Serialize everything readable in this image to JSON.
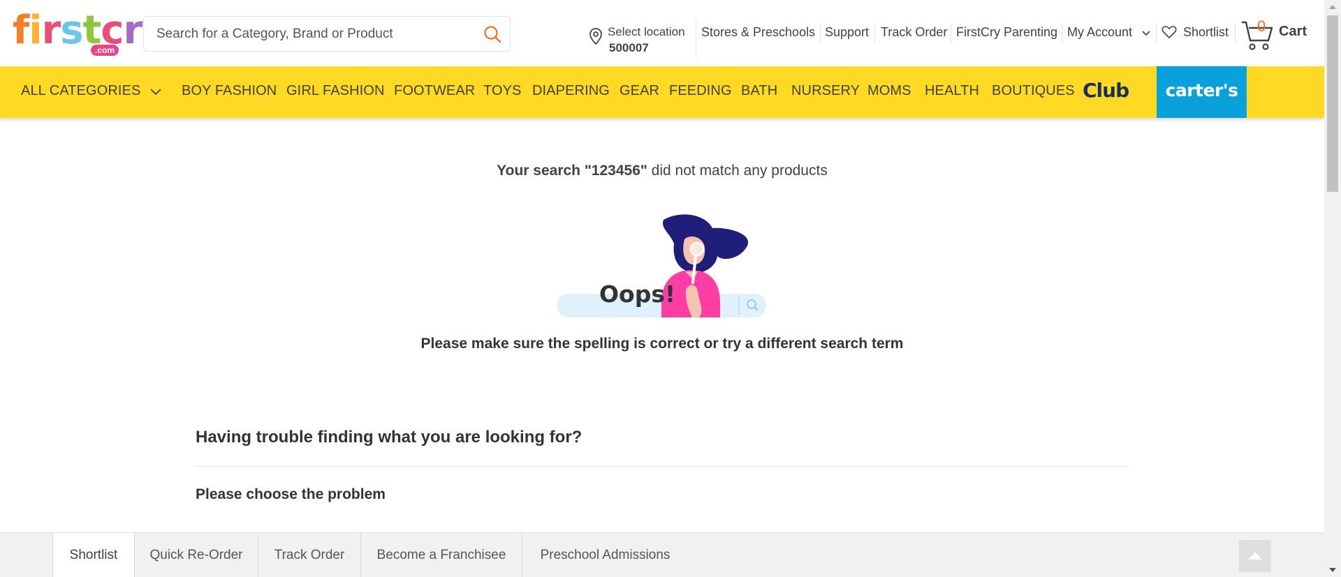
{
  "header": {
    "logo_text": "firstcry",
    "logo_suffix": ".com",
    "search": {
      "placeholder": "Search for a Category, Brand or Product",
      "value": ""
    },
    "location": {
      "label": "Select location",
      "pincode": "500007"
    },
    "links": {
      "stores": "Stores & Preschools",
      "support": "Support",
      "track_order": "Track Order",
      "parenting": "FirstCry Parenting",
      "my_account": "My Account",
      "shortlist": "Shortlist",
      "cart": "Cart",
      "cart_count": "0"
    }
  },
  "categories": {
    "all": "ALL CATEGORIES",
    "items": [
      "BOY FASHION",
      "GIRL FASHION",
      "FOOTWEAR",
      "TOYS",
      "DIAPERING",
      "GEAR",
      "FEEDING",
      "BATH",
      "NURSERY",
      "MOMS",
      "HEALTH",
      "BOUTIQUES"
    ],
    "club": "Club",
    "carters": "carter's"
  },
  "main": {
    "nomatch_prefix": "Your search ",
    "query": "\"123456\"",
    "nomatch_suffix": " did not match any products",
    "oops": "Oops!",
    "hint": "Please make sure the spelling is correct or try a different search term",
    "trouble_heading": "Having trouble finding what you are looking for?",
    "choose_problem": "Please choose the problem"
  },
  "bottom_bar": {
    "tabs": [
      "Shortlist",
      "Quick Re-Order",
      "Track Order",
      "Become a Franchisee",
      "Preschool Admissions"
    ]
  },
  "colors": {
    "brand_yellow": "#ffd923",
    "carters_blue": "#0aa0d9",
    "accent_orange": "#f36c21",
    "oops_pink": "#ff3ea5",
    "hair_navy": "#1f1f7a"
  }
}
